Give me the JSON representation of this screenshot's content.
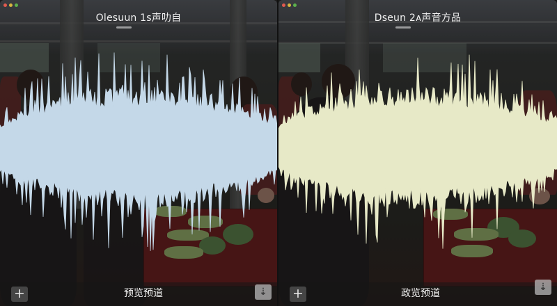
{
  "panels": [
    {
      "id": "left",
      "title": "Olesuun 1s声叻自",
      "preview_label": "预览预道",
      "add_icon": "plus-icon",
      "download_icon": "download-arrow-icon",
      "waveform_color": "#c4d8e8",
      "traffic_lights": [
        "#e25a4f",
        "#d6b640",
        "#5cb14d"
      ]
    },
    {
      "id": "right",
      "title": "Dseun 2ᴀ声音方品",
      "preview_label": "政览预道",
      "add_icon": "plus-icon",
      "download_icon": "download-arrow-icon",
      "waveform_color": "#e7e9c7",
      "traffic_lights": [
        "#e25a4f",
        "#d6b640",
        "#5cb14d"
      ]
    }
  ]
}
